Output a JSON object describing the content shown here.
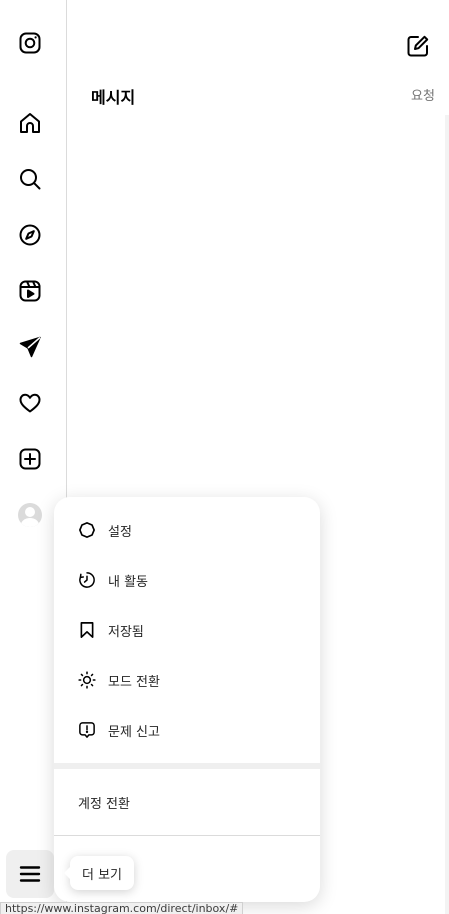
{
  "rail": {
    "items": [
      {
        "icon": "instagram-icon"
      },
      {
        "icon": "home-icon"
      },
      {
        "icon": "search-icon"
      },
      {
        "icon": "explore-icon"
      },
      {
        "icon": "reels-icon"
      },
      {
        "icon": "direct-messages-icon"
      },
      {
        "icon": "heart-icon"
      },
      {
        "icon": "create-icon"
      },
      {
        "icon": "profile-avatar"
      },
      {
        "icon": "hamburger-menu-icon"
      }
    ]
  },
  "inbox": {
    "title": "메시지",
    "requests_label": "요청"
  },
  "more_menu": {
    "items": [
      {
        "label": "설정",
        "icon": "settings-icon"
      },
      {
        "label": "내 활동",
        "icon": "activity-icon"
      },
      {
        "label": "저장됨",
        "icon": "bookmark-icon"
      },
      {
        "label": "모드 전환",
        "icon": "sun-icon"
      },
      {
        "label": "문제 신고",
        "icon": "report-icon"
      }
    ],
    "switch_accounts_label": "계정 전환"
  },
  "tooltip": {
    "text": "더 보기"
  },
  "status_bar": {
    "url": "https://www.instagram.com/direct/inbox/#"
  }
}
